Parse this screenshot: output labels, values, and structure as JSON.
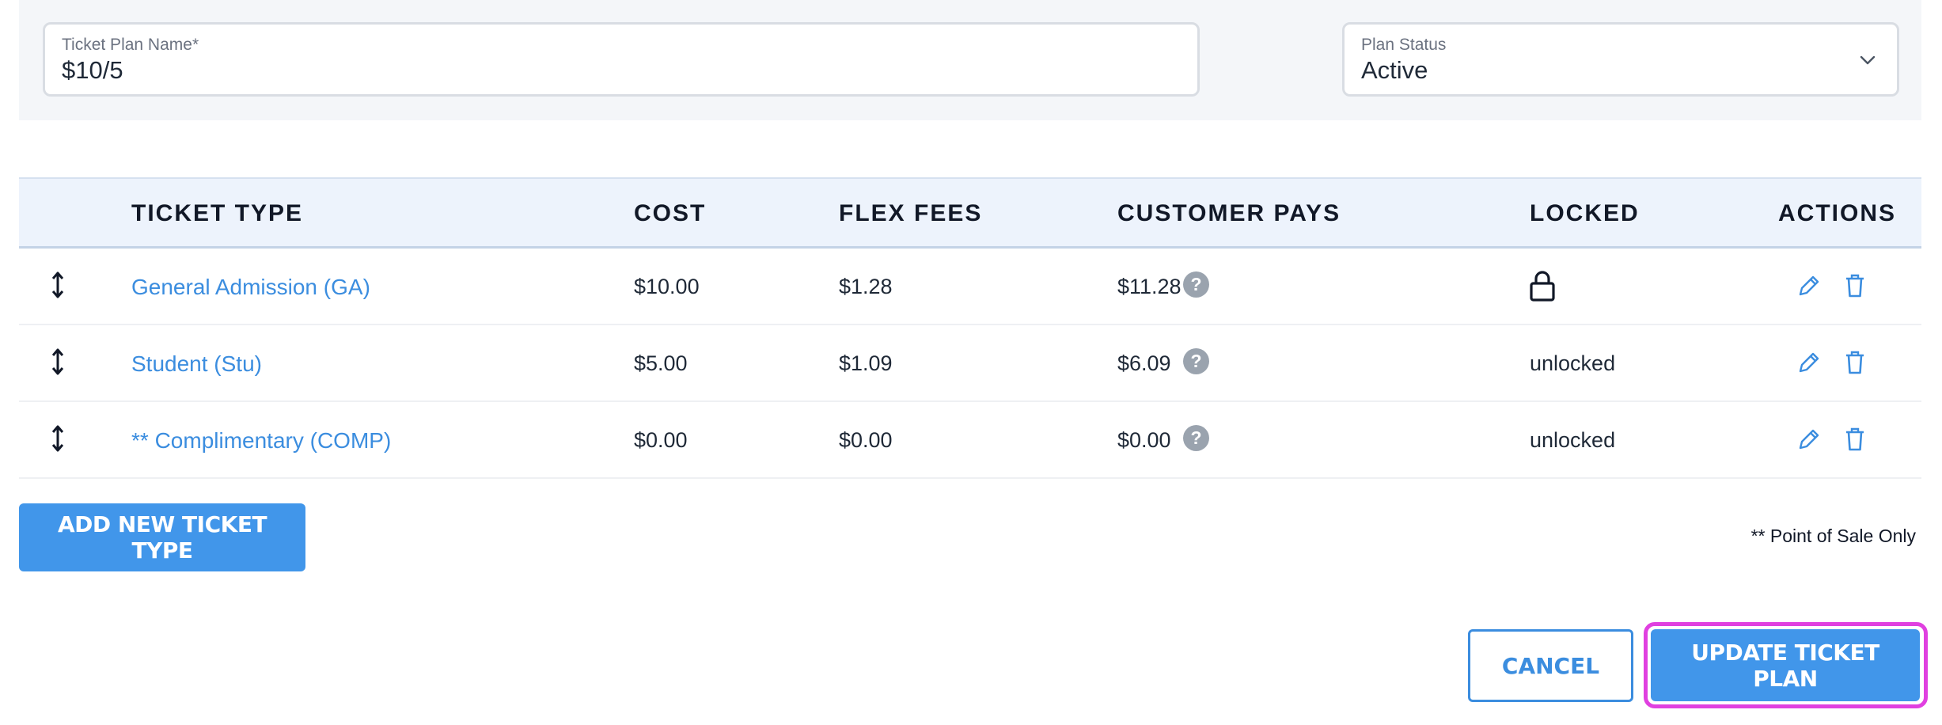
{
  "form": {
    "plan_name_label": "Ticket Plan Name*",
    "plan_name_value": "$10/5",
    "plan_status_label": "Plan Status",
    "plan_status_value": "Active"
  },
  "table": {
    "columns": [
      "TICKET TYPE",
      "COST",
      "FLEX FEES",
      "CUSTOMER PAYS",
      "LOCKED",
      "ACTIONS"
    ],
    "rows": [
      {
        "ticket_type": "General Admission (GA)",
        "cost": "$10.00",
        "flex_fees": "$1.28",
        "customer_pays": "$11.28",
        "locked": "",
        "locked_icon": "lock-icon"
      },
      {
        "ticket_type": "Student (Stu)",
        "cost": "$5.00",
        "flex_fees": "$1.09",
        "customer_pays": "$6.09",
        "locked": "unlocked"
      },
      {
        "ticket_type": "** Complimentary (COMP)",
        "cost": "$0.00",
        "flex_fees": "$0.00",
        "customer_pays": "$0.00",
        "locked": "unlocked"
      }
    ],
    "help_glyph": "?"
  },
  "buttons": {
    "add_new": "ADD NEW TICKET TYPE",
    "cancel": "CANCEL",
    "update": "UPDATE TICKET PLAN"
  },
  "note": "** Point of Sale Only",
  "colors": {
    "accent": "#4196ea",
    "link": "#3b8ddf",
    "focus_ring": "#e040e0",
    "header_bg": "#edf3fc",
    "panel_bg": "#f4f6f9"
  }
}
